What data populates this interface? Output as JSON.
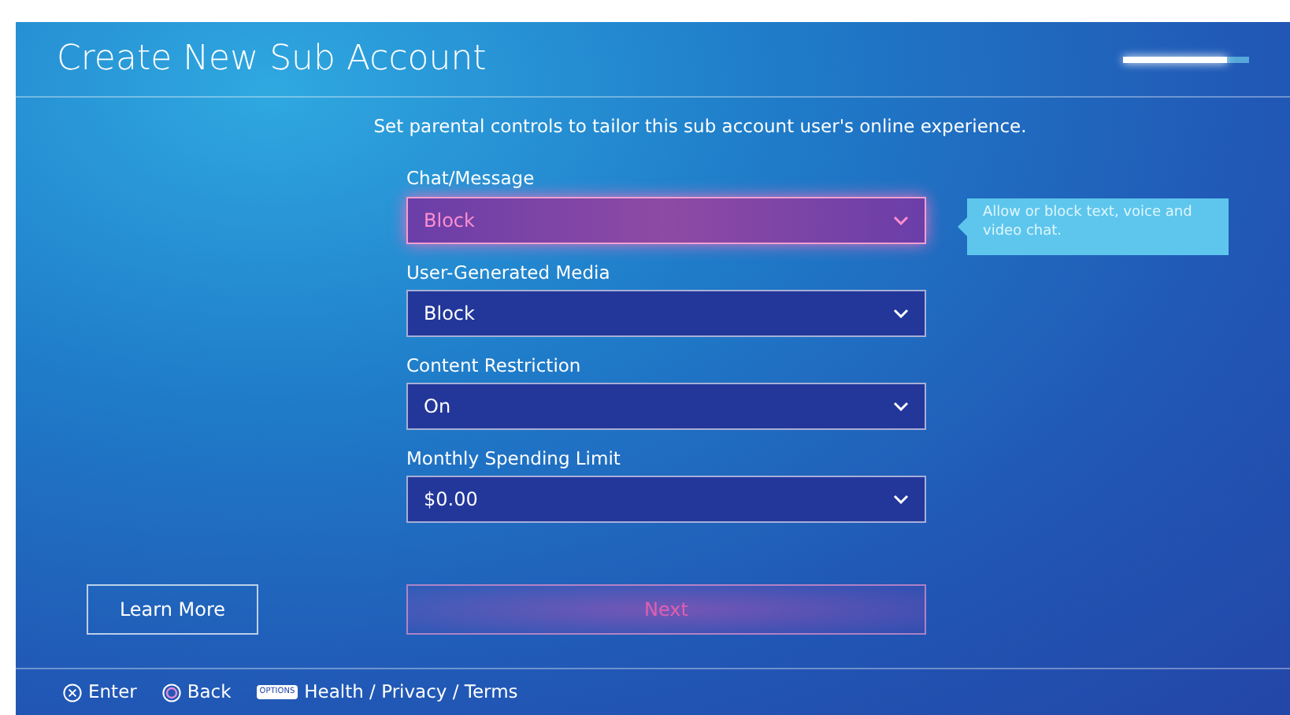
{
  "header": {
    "title": "Create New Sub Account",
    "progress": {
      "level": 0.82
    }
  },
  "subtitle": "Set parental controls to tailor this sub account user's online experience.",
  "fields": [
    {
      "label": "Chat/Message",
      "value": "Block",
      "focused": true
    },
    {
      "label": "User-Generated Media",
      "value": "Block",
      "focused": false
    },
    {
      "label": "Content Restriction",
      "value": "On",
      "focused": false
    },
    {
      "label": "Monthly Spending Limit",
      "value": "$0.00",
      "focused": false
    }
  ],
  "tooltip": "Allow or block text, voice and video chat.",
  "buttons": [
    {
      "label": "Learn More",
      "disabled": false
    },
    {
      "label": "Next",
      "disabled": true
    }
  ],
  "footer": [
    {
      "kind": "cross",
      "label": "Enter"
    },
    {
      "kind": "circle",
      "label": "Back"
    },
    {
      "kind": "options",
      "badge": "OPTIONS",
      "label": "Health / Privacy / Terms"
    }
  ]
}
